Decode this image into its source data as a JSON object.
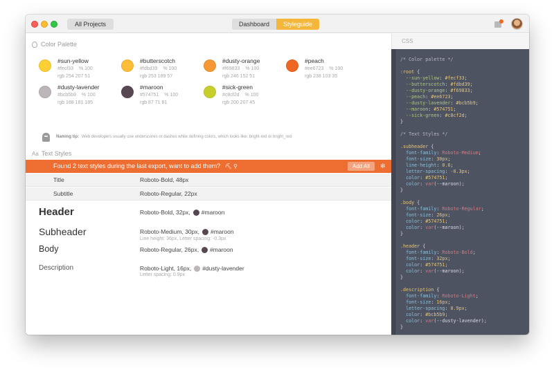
{
  "titlebar": {
    "all_projects_label": "All Projects",
    "tabs": [
      {
        "label": "Dashboard",
        "active": false
      },
      {
        "label": "Styleguide",
        "active": true
      }
    ],
    "notification_icon": "notification-icon",
    "avatar": "user-avatar"
  },
  "color_palette": {
    "heading": "Color Palette",
    "heading_icon": "drop-icon",
    "swatches": [
      {
        "name": "#sun-yellow",
        "hex": "#fecf33",
        "alpha": "% 100",
        "rgb": "rgb 254 207 51",
        "color": "#fecf33"
      },
      {
        "name": "#butterscotch",
        "hex": "#fdbd39",
        "alpha": "% 100",
        "rgb": "rgb 253 189 57",
        "color": "#fdbd39"
      },
      {
        "name": "#dusty-orange",
        "hex": "#f69833",
        "alpha": "% 100",
        "rgb": "rgb 246 152 51",
        "color": "#f69833"
      },
      {
        "name": "#peach",
        "hex": "#ee6723",
        "alpha": "% 100",
        "rgb": "rgb 238 103 35",
        "color": "#ee6723"
      },
      {
        "name": "#dusty-lavender",
        "hex": "#bcb5b9",
        "alpha": "% 100",
        "rgb": "rgb 188 181 185",
        "color": "#bcb5b9"
      },
      {
        "name": "#maroon",
        "hex": "#574751",
        "alpha": "% 100",
        "rgb": "rgb 87 71 81",
        "color": "#574751"
      },
      {
        "name": "#sick-green",
        "hex": "#c8cf2d",
        "alpha": "% 100",
        "rgb": "rgb 200 207 45",
        "color": "#c8cf2d"
      }
    ],
    "tip_label": "Naming tip:",
    "tip_text": "Web developers usually use underscores or dashes while defining colors, which looks like: bright-red or bright_red"
  },
  "text_styles": {
    "heading_prefix": "Aa",
    "heading": "Text Styles",
    "banner": {
      "message": "Found 2 text styles during the last export, want to add them?",
      "extra": "⛏ ⚲",
      "button": "Add All",
      "close": "✻"
    },
    "pending": [
      {
        "name": "Title",
        "spec": "Roboto-Bold, 48px"
      },
      {
        "name": "Subtitle",
        "spec": "Roboto-Regular, 22px"
      }
    ],
    "styles": [
      {
        "name": "Header",
        "spec": "Roboto-Bold, 32px,",
        "color_name": "#maroon",
        "color": "#574751",
        "sub": ""
      },
      {
        "name": "Subheader",
        "spec": "Roboto-Medium, 30px,",
        "color_name": "#maroon",
        "color": "#574751",
        "sub": "Line height: 36px, Letter spacing: -0.3px"
      },
      {
        "name": "Body",
        "spec": "Roboto-Regular, 26px,",
        "color_name": "#maroon",
        "color": "#574751",
        "sub": ""
      },
      {
        "name": "Description",
        "spec": "Roboto-Light, 16px,",
        "color_name": "#dusty-lavender",
        "color": "#bcb5b9",
        "sub": "Letter spacing: 0.9px"
      }
    ]
  },
  "css_panel": {
    "heading": "CSS",
    "lines": [
      [
        [
          "c-comment",
          "/* Color palette */"
        ]
      ],
      [
        [
          "",
          ""
        ]
      ],
      [
        [
          "c-sel",
          ":root"
        ],
        [
          "",
          " {"
        ]
      ],
      [
        [
          "",
          "  "
        ],
        [
          "c-var",
          "--sun-yellow"
        ],
        [
          "",
          ": "
        ],
        [
          "c-val",
          "#fecf33"
        ],
        [
          "",
          ";"
        ]
      ],
      [
        [
          "",
          "  "
        ],
        [
          "c-var",
          "--butterscotch"
        ],
        [
          "",
          ": "
        ],
        [
          "c-val",
          "#fdbd39"
        ],
        [
          "",
          ";"
        ]
      ],
      [
        [
          "",
          "  "
        ],
        [
          "c-var",
          "--dusty-orange"
        ],
        [
          "",
          ": "
        ],
        [
          "c-val",
          "#f69833"
        ],
        [
          "",
          ";"
        ]
      ],
      [
        [
          "",
          "  "
        ],
        [
          "c-var",
          "--peach"
        ],
        [
          "",
          ": "
        ],
        [
          "c-val",
          "#ee6723"
        ],
        [
          "",
          ";"
        ]
      ],
      [
        [
          "",
          "  "
        ],
        [
          "c-var",
          "--dusty-lavender"
        ],
        [
          "",
          ": "
        ],
        [
          "c-val",
          "#bcb5b9"
        ],
        [
          "",
          ";"
        ]
      ],
      [
        [
          "",
          "  "
        ],
        [
          "c-var",
          "--maroon"
        ],
        [
          "",
          ": "
        ],
        [
          "c-val",
          "#574751"
        ],
        [
          "",
          ";"
        ]
      ],
      [
        [
          "",
          "  "
        ],
        [
          "c-var",
          "--sick-green"
        ],
        [
          "",
          ": "
        ],
        [
          "c-val",
          "#c8cf2d"
        ],
        [
          "",
          ";"
        ]
      ],
      [
        [
          "",
          "}"
        ]
      ],
      [
        [
          "",
          ""
        ]
      ],
      [
        [
          "c-comment",
          "/* Text Styles */"
        ]
      ],
      [
        [
          "",
          ""
        ]
      ],
      [
        [
          "c-sel",
          ".subheader"
        ],
        [
          "",
          " {"
        ]
      ],
      [
        [
          "",
          "  "
        ],
        [
          "c-prop",
          "font-family"
        ],
        [
          "",
          ": "
        ],
        [
          "c-str",
          "Roboto-Medium"
        ],
        [
          "",
          ";"
        ]
      ],
      [
        [
          "",
          "  "
        ],
        [
          "c-prop",
          "font-size"
        ],
        [
          "",
          ": "
        ],
        [
          "c-num",
          "30px"
        ],
        [
          "",
          ";"
        ]
      ],
      [
        [
          "",
          "  "
        ],
        [
          "c-prop",
          "line-height"
        ],
        [
          "",
          ": "
        ],
        [
          "c-num",
          "0.6"
        ],
        [
          "",
          ";"
        ]
      ],
      [
        [
          "",
          "  "
        ],
        [
          "c-prop",
          "letter-spacing"
        ],
        [
          "",
          ": "
        ],
        [
          "c-num",
          "-0.3px"
        ],
        [
          "",
          ";"
        ]
      ],
      [
        [
          "",
          "  "
        ],
        [
          "c-prop",
          "color"
        ],
        [
          "",
          ": "
        ],
        [
          "c-val",
          "#574751"
        ],
        [
          "",
          ";"
        ]
      ],
      [
        [
          "",
          "  "
        ],
        [
          "c-prop",
          "color"
        ],
        [
          "",
          ": "
        ],
        [
          "c-str",
          "var"
        ],
        [
          "",
          "(--maroon);"
        ]
      ],
      [
        [
          "",
          "}"
        ]
      ],
      [
        [
          "",
          ""
        ]
      ],
      [
        [
          "c-sel",
          ".body"
        ],
        [
          "",
          " {"
        ]
      ],
      [
        [
          "",
          "  "
        ],
        [
          "c-prop",
          "font-family"
        ],
        [
          "",
          ": "
        ],
        [
          "c-str",
          "Roboto-Regular"
        ],
        [
          "",
          ";"
        ]
      ],
      [
        [
          "",
          "  "
        ],
        [
          "c-prop",
          "font-size"
        ],
        [
          "",
          ": "
        ],
        [
          "c-num",
          "26px"
        ],
        [
          "",
          ";"
        ]
      ],
      [
        [
          "",
          "  "
        ],
        [
          "c-prop",
          "color"
        ],
        [
          "",
          ": "
        ],
        [
          "c-val",
          "#574751"
        ],
        [
          "",
          ";"
        ]
      ],
      [
        [
          "",
          "  "
        ],
        [
          "c-prop",
          "color"
        ],
        [
          "",
          ": "
        ],
        [
          "c-str",
          "var"
        ],
        [
          "",
          "(--maroon);"
        ]
      ],
      [
        [
          "",
          "}"
        ]
      ],
      [
        [
          "",
          ""
        ]
      ],
      [
        [
          "c-sel",
          ".header"
        ],
        [
          "",
          " {"
        ]
      ],
      [
        [
          "",
          "  "
        ],
        [
          "c-prop",
          "font-family"
        ],
        [
          "",
          ": "
        ],
        [
          "c-str",
          "Roboto-Bold"
        ],
        [
          "",
          ";"
        ]
      ],
      [
        [
          "",
          "  "
        ],
        [
          "c-prop",
          "font-size"
        ],
        [
          "",
          ": "
        ],
        [
          "c-num",
          "32px"
        ],
        [
          "",
          ";"
        ]
      ],
      [
        [
          "",
          "  "
        ],
        [
          "c-prop",
          "color"
        ],
        [
          "",
          ": "
        ],
        [
          "c-val",
          "#574751"
        ],
        [
          "",
          ";"
        ]
      ],
      [
        [
          "",
          "  "
        ],
        [
          "c-prop",
          "color"
        ],
        [
          "",
          ": "
        ],
        [
          "c-str",
          "var"
        ],
        [
          "",
          "(--maroon);"
        ]
      ],
      [
        [
          "",
          "}"
        ]
      ],
      [
        [
          "",
          ""
        ]
      ],
      [
        [
          "c-sel",
          ".description"
        ],
        [
          "",
          " {"
        ]
      ],
      [
        [
          "",
          "  "
        ],
        [
          "c-prop",
          "font-family"
        ],
        [
          "",
          ": "
        ],
        [
          "c-str",
          "Roboto-Light"
        ],
        [
          "",
          ";"
        ]
      ],
      [
        [
          "",
          "  "
        ],
        [
          "c-prop",
          "font-size"
        ],
        [
          "",
          ": "
        ],
        [
          "c-num",
          "16px"
        ],
        [
          "",
          ";"
        ]
      ],
      [
        [
          "",
          "  "
        ],
        [
          "c-prop",
          "letter-spacing"
        ],
        [
          "",
          ": "
        ],
        [
          "c-num",
          "0.9px"
        ],
        [
          "",
          ";"
        ]
      ],
      [
        [
          "",
          "  "
        ],
        [
          "c-prop",
          "color"
        ],
        [
          "",
          ": "
        ],
        [
          "c-val",
          "#bcb5b9"
        ],
        [
          "",
          ";"
        ]
      ],
      [
        [
          "",
          "  "
        ],
        [
          "c-prop",
          "color"
        ],
        [
          "",
          ": "
        ],
        [
          "c-str",
          "var"
        ],
        [
          "",
          "(--dusty-lavender);"
        ]
      ],
      [
        [
          "",
          "}"
        ]
      ]
    ]
  }
}
